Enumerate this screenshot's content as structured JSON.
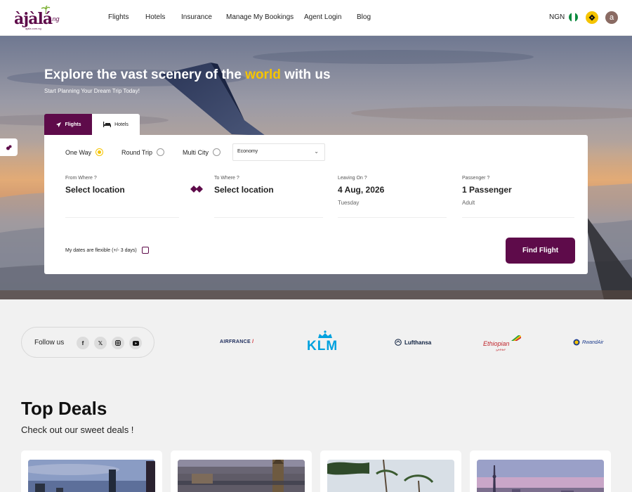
{
  "header": {
    "logo": {
      "text": "àjàlá",
      "tld": ".ng",
      "tagline": "ajala.com.ng"
    },
    "nav": [
      {
        "label": "Flights"
      },
      {
        "label": "Hotels"
      },
      {
        "label": "Insurance"
      },
      {
        "label": "Manage My Bookings"
      },
      {
        "label": "Agent Login"
      },
      {
        "label": "Blog"
      }
    ],
    "currency": "NGN",
    "avatar_initial": "a"
  },
  "hero": {
    "title_pre": "Explore the vast scenery of the ",
    "title_highlight": "world",
    "title_post": " with us",
    "subtitle": "Start Planning Your Dream Trip Today!"
  },
  "search": {
    "tabs": [
      {
        "label": "Flights",
        "icon": "plane-icon",
        "active": true
      },
      {
        "label": "Hotels",
        "icon": "bed-icon",
        "active": false
      }
    ],
    "trip_types": [
      {
        "label": "One Way",
        "selected": true
      },
      {
        "label": "Round Trip",
        "selected": false
      },
      {
        "label": "Multi City",
        "selected": false
      }
    ],
    "cabin_class": "Economy",
    "from": {
      "label": "From Where ?",
      "value": "Select location"
    },
    "to": {
      "label": "To Where ?",
      "value": "Select location"
    },
    "date": {
      "label": "Leaving On ?",
      "value": "4 Aug, 2026",
      "weekday": "Tuesday"
    },
    "passengers": {
      "label": "Passenger ?",
      "value": "1 Passenger",
      "type": "Adult"
    },
    "flexible_label": "My dates are flexible (+/- 3 days)",
    "find_button": "Find Flight"
  },
  "follow": {
    "label": "Follow us",
    "networks": [
      "facebook-icon",
      "x-icon",
      "instagram-icon",
      "youtube-icon"
    ]
  },
  "airlines": [
    {
      "name": "AIRFRANCE"
    },
    {
      "name": "KLM"
    },
    {
      "name": "Lufthansa"
    },
    {
      "name": "Ethiopian",
      "sub": "ኢትዮጵያ"
    },
    {
      "name": "RwandAir"
    }
  ],
  "deals": {
    "title": "Top Deals",
    "subtitle": "Check out our sweet deals !"
  },
  "colors": {
    "brand": "#5e0b4a",
    "accent": "#f5c400"
  }
}
